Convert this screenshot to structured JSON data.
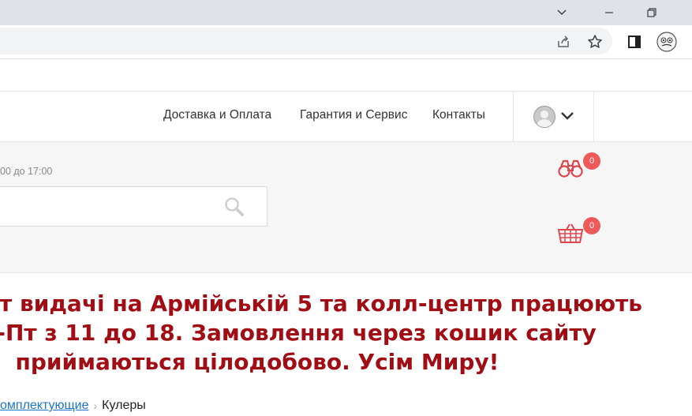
{
  "nav": {
    "items": [
      {
        "label": "Доставка и Оплата"
      },
      {
        "label": "Гарантия и Сервис"
      },
      {
        "label": "Контакты"
      }
    ]
  },
  "header": {
    "hours_text": "00 до 17:00",
    "compare_count": "0",
    "cart_count": "0"
  },
  "announcement": {
    "line1": "т видачі на Армійській 5 та колл-центр працюють",
    "line2": "н-Пт з 11 до 18. Замовлення через кошик сайту",
    "line3": "приймаються цілодобово. Усім Миру!"
  },
  "breadcrumb": {
    "parent": "омплектующие",
    "separator": "›",
    "current": "Кулеры"
  },
  "colors": {
    "accent_red": "#a10d14",
    "badge_red": "#ee5a5a",
    "icon_red": "#e0474c",
    "link_blue": "#1a73c8"
  },
  "icons": {
    "compare": "binoculars-icon",
    "cart": "basket-icon",
    "search": "search-icon",
    "user": "user-avatar-icon",
    "dropdown": "chevron-down-icon"
  }
}
